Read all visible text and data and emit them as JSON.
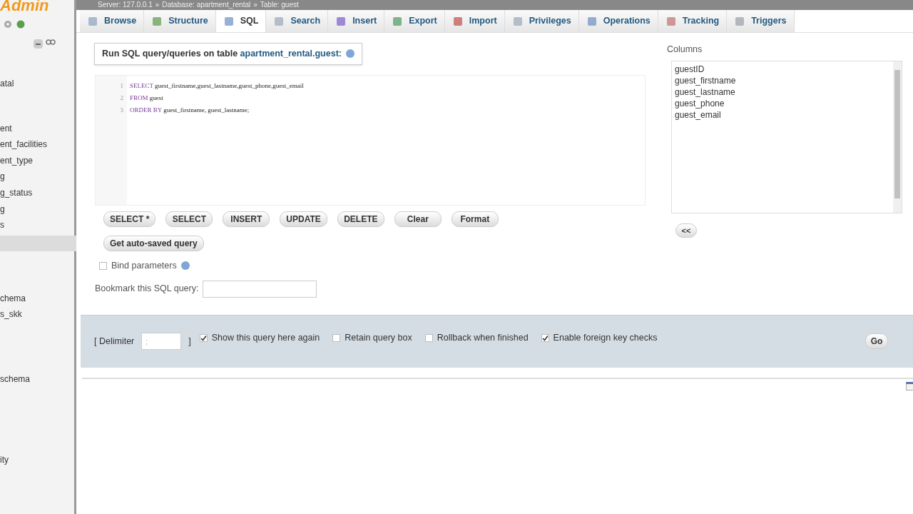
{
  "sidebar": {
    "logo": "Admin",
    "groups": [
      {
        "items": [
          "atal"
        ]
      },
      {
        "items": [
          "ent",
          "ent_facilities",
          "ent_type",
          "g",
          "g_status",
          "g",
          "s"
        ]
      },
      {
        "items": [
          "chema",
          "s_skk"
        ]
      },
      {
        "items": [
          "schema"
        ]
      },
      {
        "items": [
          "ity"
        ]
      }
    ]
  },
  "breadcrumb": {
    "separator": "»",
    "items": [
      "Server: 127.0.0.1",
      "Database: apartment_rental",
      "Table: guest"
    ]
  },
  "tabs": [
    {
      "label": "Browse",
      "selected": false
    },
    {
      "label": "Structure",
      "selected": false
    },
    {
      "label": "SQL",
      "selected": true
    },
    {
      "label": "Search",
      "selected": false
    },
    {
      "label": "Insert",
      "selected": false
    },
    {
      "label": "Export",
      "selected": false
    },
    {
      "label": "Import",
      "selected": false
    },
    {
      "label": "Privileges",
      "selected": false
    },
    {
      "label": "Operations",
      "selected": false
    },
    {
      "label": "Tracking",
      "selected": false
    },
    {
      "label": "Triggers",
      "selected": false
    }
  ],
  "query_panel": {
    "title": "Run SQL query/queries on table",
    "table": "apartment_rental.guest:"
  },
  "editor": {
    "lines": [
      {
        "number": "1",
        "tokens": [
          {
            "kind": "keyword",
            "text": "SELECT"
          },
          {
            "kind": "plain",
            "text": "guest_firstname,guest_lastname,guest_phone,guest_email"
          }
        ]
      },
      {
        "number": "2",
        "tokens": [
          {
            "kind": "keyword",
            "text": "FROM"
          },
          {
            "kind": "plain",
            "text": "guest"
          }
        ]
      },
      {
        "number": "3",
        "tokens": [
          {
            "kind": "keyword",
            "text": "ORDER BY"
          },
          {
            "kind": "plain",
            "text": "guest_firstname, guest_lastname;"
          }
        ]
      }
    ]
  },
  "query_buttons": [
    "SELECT *",
    "SELECT",
    "INSERT",
    "UPDATE",
    "DELETE",
    "Clear",
    "Format"
  ],
  "autosave_button": "Get auto-saved query",
  "bind_parameters": {
    "label": "Bind parameters",
    "checked": false
  },
  "bookmark": {
    "label": "Bookmark this SQL query:"
  },
  "columns": {
    "title": "Columns",
    "items": [
      "guestID",
      "guest_firstname",
      "guest_lastname",
      "guest_phone",
      "guest_email"
    ],
    "insert_button": "<<"
  },
  "footer": {
    "delimiter_label": "[ Delimiter",
    "delimiter_value": ";",
    "delimiter_close": "]",
    "options": [
      {
        "label": "Show this query here again",
        "checked": true
      },
      {
        "label": "Retain query box",
        "checked": false
      },
      {
        "label": "Rollback when finished",
        "checked": false
      },
      {
        "label": "Enable foreign key checks",
        "checked": true
      }
    ],
    "go": "Go"
  }
}
